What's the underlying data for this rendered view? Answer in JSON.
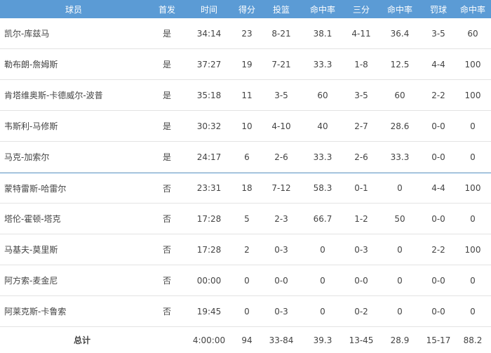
{
  "headers": {
    "name": "球员",
    "starter": "首发",
    "minutes": "时间",
    "points": "得分",
    "fg": "投篮",
    "fg_pct": "命中率",
    "three": "三分",
    "three_pct": "命中率",
    "ft": "罚球",
    "ft_pct": "命中率"
  },
  "players": [
    {
      "name": "凯尔-库兹马",
      "starter": "是",
      "minutes": "34:14",
      "points": "23",
      "fg": "8-21",
      "fg_pct": "38.1",
      "three": "4-11",
      "three_pct": "36.4",
      "ft": "3-5",
      "ft_pct": "60"
    },
    {
      "name": "勒布朗-詹姆斯",
      "starter": "是",
      "minutes": "37:27",
      "points": "19",
      "fg": "7-21",
      "fg_pct": "33.3",
      "three": "1-8",
      "three_pct": "12.5",
      "ft": "4-4",
      "ft_pct": "100"
    },
    {
      "name": "肯塔维奥斯-卡德威尔-波普",
      "starter": "是",
      "minutes": "35:18",
      "points": "11",
      "fg": "3-5",
      "fg_pct": "60",
      "three": "3-5",
      "three_pct": "60",
      "ft": "2-2",
      "ft_pct": "100"
    },
    {
      "name": "韦斯利-马修斯",
      "starter": "是",
      "minutes": "30:32",
      "points": "10",
      "fg": "4-10",
      "fg_pct": "40",
      "three": "2-7",
      "three_pct": "28.6",
      "ft": "0-0",
      "ft_pct": "0"
    },
    {
      "name": "马克-加索尔",
      "starter": "是",
      "minutes": "24:17",
      "points": "6",
      "fg": "2-6",
      "fg_pct": "33.3",
      "three": "2-6",
      "three_pct": "33.3",
      "ft": "0-0",
      "ft_pct": "0"
    },
    {
      "name": "蒙特雷斯-哈雷尔",
      "starter": "否",
      "minutes": "23:31",
      "points": "18",
      "fg": "7-12",
      "fg_pct": "58.3",
      "three": "0-1",
      "three_pct": "0",
      "ft": "4-4",
      "ft_pct": "100"
    },
    {
      "name": "塔伦-霍顿-塔克",
      "starter": "否",
      "minutes": "17:28",
      "points": "5",
      "fg": "2-3",
      "fg_pct": "66.7",
      "three": "1-2",
      "three_pct": "50",
      "ft": "0-0",
      "ft_pct": "0"
    },
    {
      "name": "马基夫-莫里斯",
      "starter": "否",
      "minutes": "17:28",
      "points": "2",
      "fg": "0-3",
      "fg_pct": "0",
      "three": "0-3",
      "three_pct": "0",
      "ft": "2-2",
      "ft_pct": "100"
    },
    {
      "name": "阿方索-麦金尼",
      "starter": "否",
      "minutes": "00:00",
      "points": "0",
      "fg": "0-0",
      "fg_pct": "0",
      "three": "0-0",
      "three_pct": "0",
      "ft": "0-0",
      "ft_pct": "0"
    },
    {
      "name": "阿莱克斯-卡鲁索",
      "starter": "否",
      "minutes": "19:45",
      "points": "0",
      "fg": "0-3",
      "fg_pct": "0",
      "three": "0-2",
      "three_pct": "0",
      "ft": "0-0",
      "ft_pct": "0"
    }
  ],
  "totals": {
    "label": "总计",
    "starter": "",
    "minutes": "4:00:00",
    "points": "94",
    "fg": "33-84",
    "fg_pct": "39.3",
    "three": "13-45",
    "three_pct": "28.9",
    "ft": "15-17",
    "ft_pct": "88.2"
  }
}
